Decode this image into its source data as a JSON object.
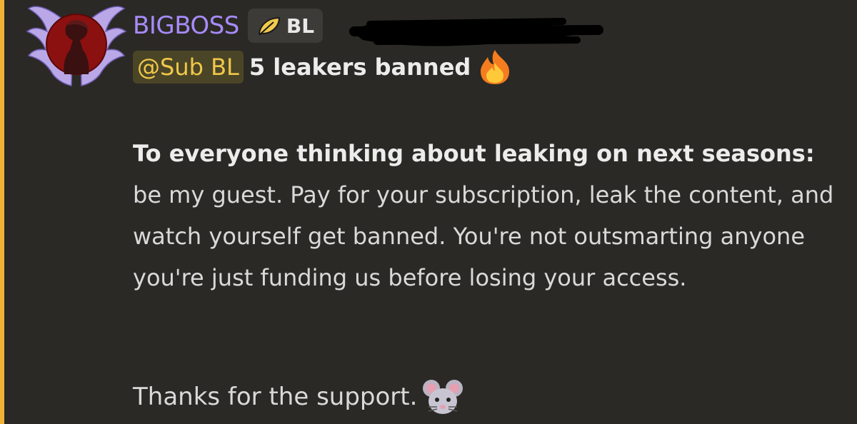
{
  "message": {
    "author": "BIGBOSS",
    "role_tag": "BL",
    "mention": "@Sub BL",
    "headline": "5 leakers banned",
    "body_lead": "To everyone thinking about leaking on next seasons:",
    "body_rest": "be my guest. Pay for your subscription, leak the content, and watch yourself get banned. You're not outsmarting anyone you're just funding us before losing your access.",
    "closing": "Thanks for the support."
  },
  "colors": {
    "accent_bar": "#f0b232",
    "username": "#a78bfa",
    "mention_text": "#f0c74a",
    "background": "#2a2926"
  },
  "icons": {
    "role_tag_icon": "leaf-icon",
    "headline_emoji": "fire-icon",
    "closing_emoji": "mouse-icon"
  }
}
